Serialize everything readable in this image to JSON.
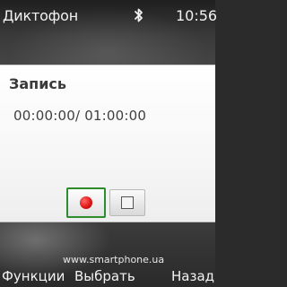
{
  "status_bar": {
    "app_name": "Диктофон",
    "bluetooth_icon": "bluetooth-icon",
    "time": "10:56"
  },
  "recorder": {
    "title": "Запись",
    "timer": "00:00:00/ 01:00:00",
    "record_icon": "record-icon",
    "stop_icon": "stop-icon",
    "record_color": "#e01818",
    "focus_color": "#2e8b2e"
  },
  "watermark": "www.smartphone.ua",
  "softkeys": {
    "left": "Функции",
    "middle": "Выбрать",
    "right": "Назад"
  }
}
